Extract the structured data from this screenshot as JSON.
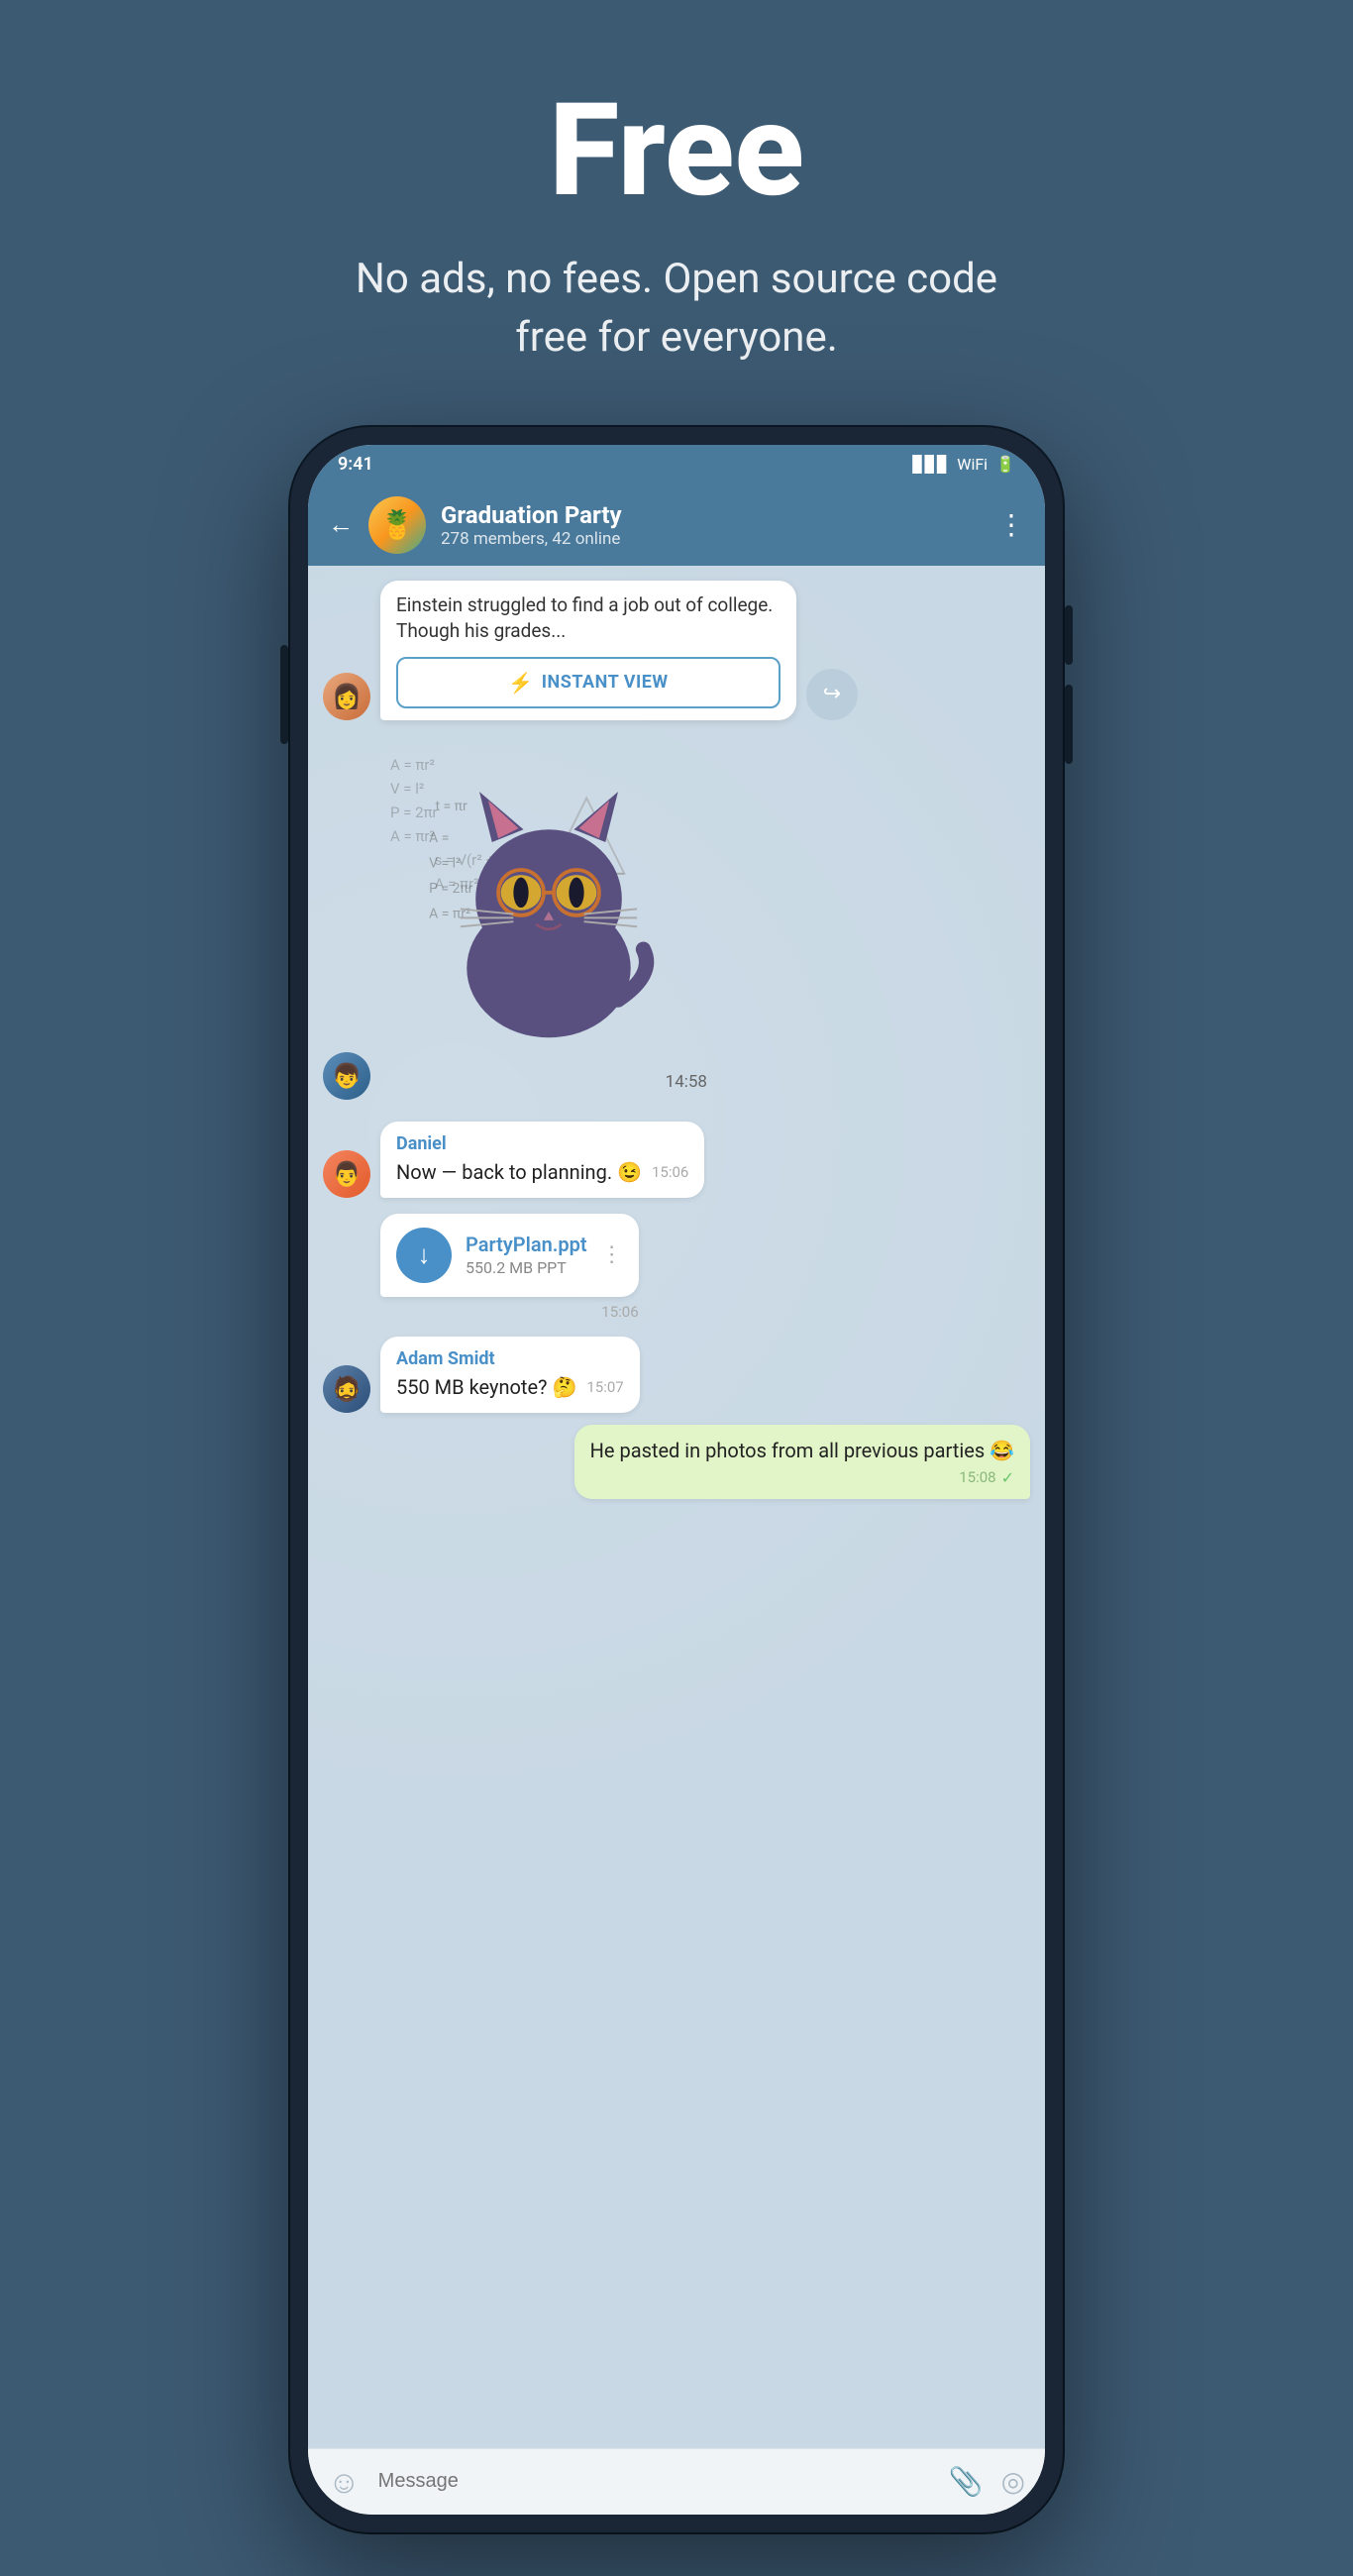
{
  "hero": {
    "title": "Free",
    "subtitle": "No ads, no fees. Open source code free for everyone."
  },
  "chat": {
    "header": {
      "back_label": "←",
      "group_name": "Graduation Party",
      "group_meta": "278 members, 42 online",
      "menu_label": "⋮"
    },
    "messages": [
      {
        "type": "article",
        "text": "Einstein struggled to find a job out of college. Though his grades...",
        "instant_view_label": "INSTANT VIEW"
      },
      {
        "type": "sticker",
        "time": "14:58"
      },
      {
        "type": "incoming",
        "sender": "Daniel",
        "text": "Now — back to planning. 😉",
        "time": "15:06"
      },
      {
        "type": "file",
        "filename": "PartyPlan.ppt",
        "filesize": "550.2 MB PPT",
        "time": "15:06"
      },
      {
        "type": "incoming",
        "sender": "Adam Smidt",
        "text": "550 MB keynote? 🤔",
        "time": "15:07"
      },
      {
        "type": "outgoing",
        "text": "He pasted in photos from all previous parties 😂",
        "time": "15:08",
        "check": "✓"
      }
    ],
    "input": {
      "placeholder": "Message",
      "emoji_icon": "☺",
      "attach_icon": "📎",
      "camera_icon": "◎"
    }
  }
}
